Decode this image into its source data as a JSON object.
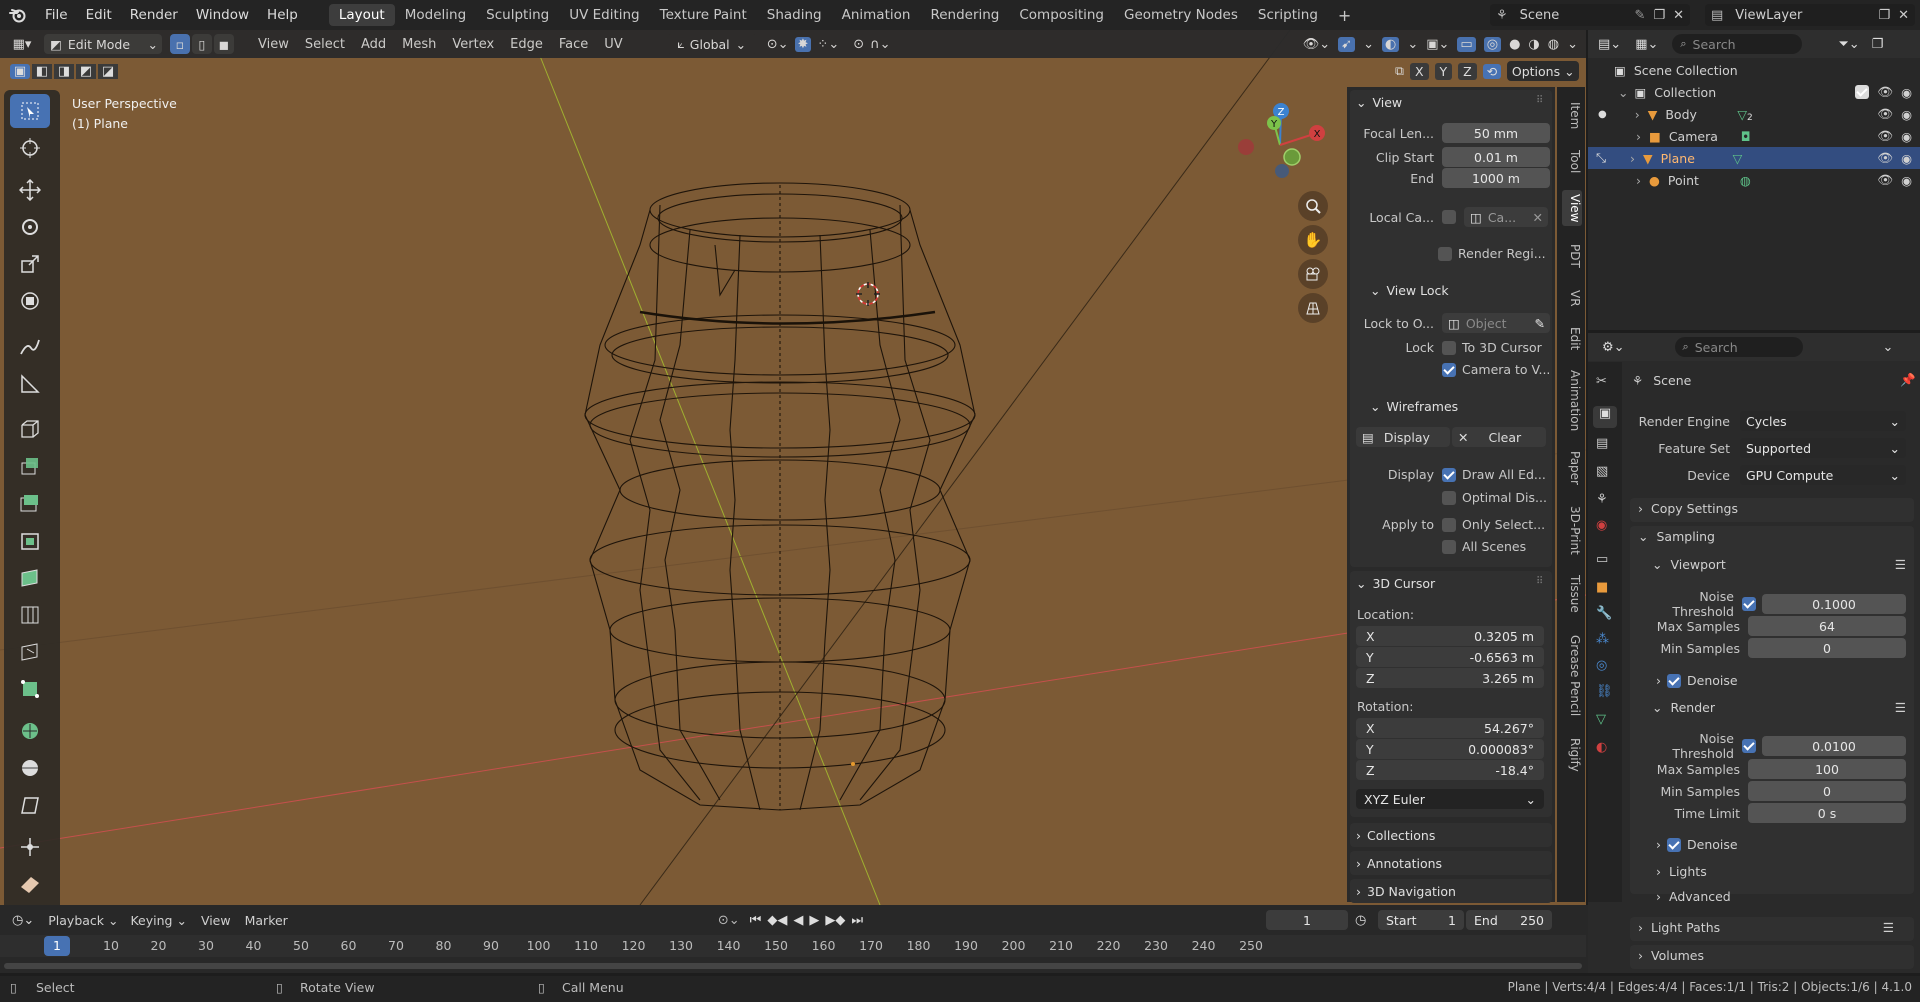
{
  "topbar": {
    "menus": [
      "File",
      "Edit",
      "Render",
      "Window",
      "Help"
    ],
    "workspaces": [
      "Layout",
      "Modeling",
      "Sculpting",
      "UV Editing",
      "Texture Paint",
      "Shading",
      "Animation",
      "Rendering",
      "Compositing",
      "Geometry Nodes",
      "Scripting"
    ],
    "active_workspace": "Layout",
    "add": "+",
    "scene": "Scene",
    "view_layer": "ViewLayer"
  },
  "viewport_header": {
    "mode": "Edit Mode",
    "menus": [
      "View",
      "Select",
      "Add",
      "Mesh",
      "Vertex",
      "Edge",
      "Face",
      "UV"
    ],
    "orientation": "Global",
    "options": "Options",
    "axes": [
      "X",
      "Y",
      "Z"
    ]
  },
  "viewport": {
    "perspective": "User Perspective",
    "object": "(1) Plane",
    "bg": "#7c5a35",
    "x_axis_color": "#c5504c",
    "y_axis_color": "#a0b030",
    "gizmo": {
      "z": "Z",
      "y": "Y",
      "x": "X"
    }
  },
  "npanel": {
    "view": {
      "title": "View",
      "focal_label": "Focal Len...",
      "focal": "50 mm",
      "clip_start_label": "Clip Start",
      "clip_start": "0.01 m",
      "end_label": "End",
      "end": "1000 m",
      "local_camera_label": "Local Ca...",
      "local_camera": "Ca...",
      "render_region": "Render Regi..."
    },
    "view_lock": {
      "title": "View Lock",
      "lock_to_object_label": "Lock to O...",
      "lock_to_object": "Object",
      "lock_label": "Lock",
      "to_3d_cursor": "To 3D Cursor",
      "camera_to_view": "Camera to V..."
    },
    "wireframes": {
      "title": "Wireframes",
      "display_btn": "Display",
      "clear_btn": "Clear",
      "display_label": "Display",
      "draw_all_edges": "Draw All Ed...",
      "optimal_display": "Optimal Dis...",
      "apply_label": "Apply to",
      "only_selected": "Only Select...",
      "all_scenes": "All Scenes"
    },
    "cursor": {
      "title": "3D Cursor",
      "location_label": "Location:",
      "loc": [
        {
          "axis": "X",
          "value": "0.3205 m"
        },
        {
          "axis": "Y",
          "value": "-0.6563 m"
        },
        {
          "axis": "Z",
          "value": "3.265 m"
        }
      ],
      "rotation_label": "Rotation:",
      "rot": [
        {
          "axis": "X",
          "value": "54.267°"
        },
        {
          "axis": "Y",
          "value": "0.000083°"
        },
        {
          "axis": "Z",
          "value": "-18.4°"
        }
      ],
      "mode": "XYZ Euler"
    },
    "collapsed": [
      "Collections",
      "Annotations",
      "3D Navigation"
    ],
    "tabs": [
      "Item",
      "Tool",
      "View",
      "PDT",
      "VR",
      "Edit",
      "Animation",
      "Paper",
      "3D-Print",
      "Tissue",
      "Grease Pencil",
      "Rigify"
    ]
  },
  "outliner": {
    "search_placeholder": "Search",
    "root": "Scene Collection",
    "collection": "Collection",
    "items": [
      {
        "name": "Body",
        "badge": "2"
      },
      {
        "name": "Camera",
        "badge": ""
      },
      {
        "name": "Plane",
        "badge": ""
      },
      {
        "name": "Point",
        "badge": ""
      }
    ]
  },
  "properties": {
    "search_placeholder": "Search",
    "scene": "Scene",
    "render_engine_label": "Render Engine",
    "render_engine": "Cycles",
    "feature_set_label": "Feature Set",
    "feature_set": "Supported",
    "device_label": "Device",
    "device": "GPU Compute",
    "copy_settings": "Copy Settings",
    "sampling": "Sampling",
    "viewport": "Viewport",
    "vp_noise_label": "Noise Threshold",
    "vp_noise": "0.1000",
    "vp_max_label": "Max Samples",
    "vp_max": "64",
    "vp_min_label": "Min Samples",
    "vp_min": "0",
    "denoise": "Denoise",
    "render": "Render",
    "r_noise_label": "Noise Threshold",
    "r_noise": "0.0100",
    "r_max_label": "Max Samples",
    "r_max": "100",
    "r_min_label": "Min Samples",
    "r_min": "0",
    "time_limit_label": "Time Limit",
    "time_limit": "0 s",
    "r_denoise": "Denoise",
    "lights": "Lights",
    "advanced": "Advanced",
    "light_paths": "Light Paths",
    "volumes": "Volumes"
  },
  "timeline": {
    "playback": "Playback",
    "keying": "Keying",
    "view": "View",
    "marker": "Marker",
    "current_frame": "1",
    "start_label": "Start",
    "start": "1",
    "end_label": "End",
    "end": "250",
    "ticks": [
      "1",
      "10",
      "20",
      "30",
      "40",
      "50",
      "60",
      "70",
      "80",
      "90",
      "100",
      "110",
      "120",
      "130",
      "140",
      "150",
      "160",
      "170",
      "180",
      "190",
      "200",
      "210",
      "220",
      "230",
      "240",
      "250"
    ]
  },
  "statusbar": {
    "select": "Select",
    "rotate": "Rotate View",
    "call_menu": "Call Menu",
    "stats": "Plane | Verts:4/4 | Edges:4/4 | Faces:1/1 | Tris:2 | Objects:1/6 | 4.1.0"
  }
}
